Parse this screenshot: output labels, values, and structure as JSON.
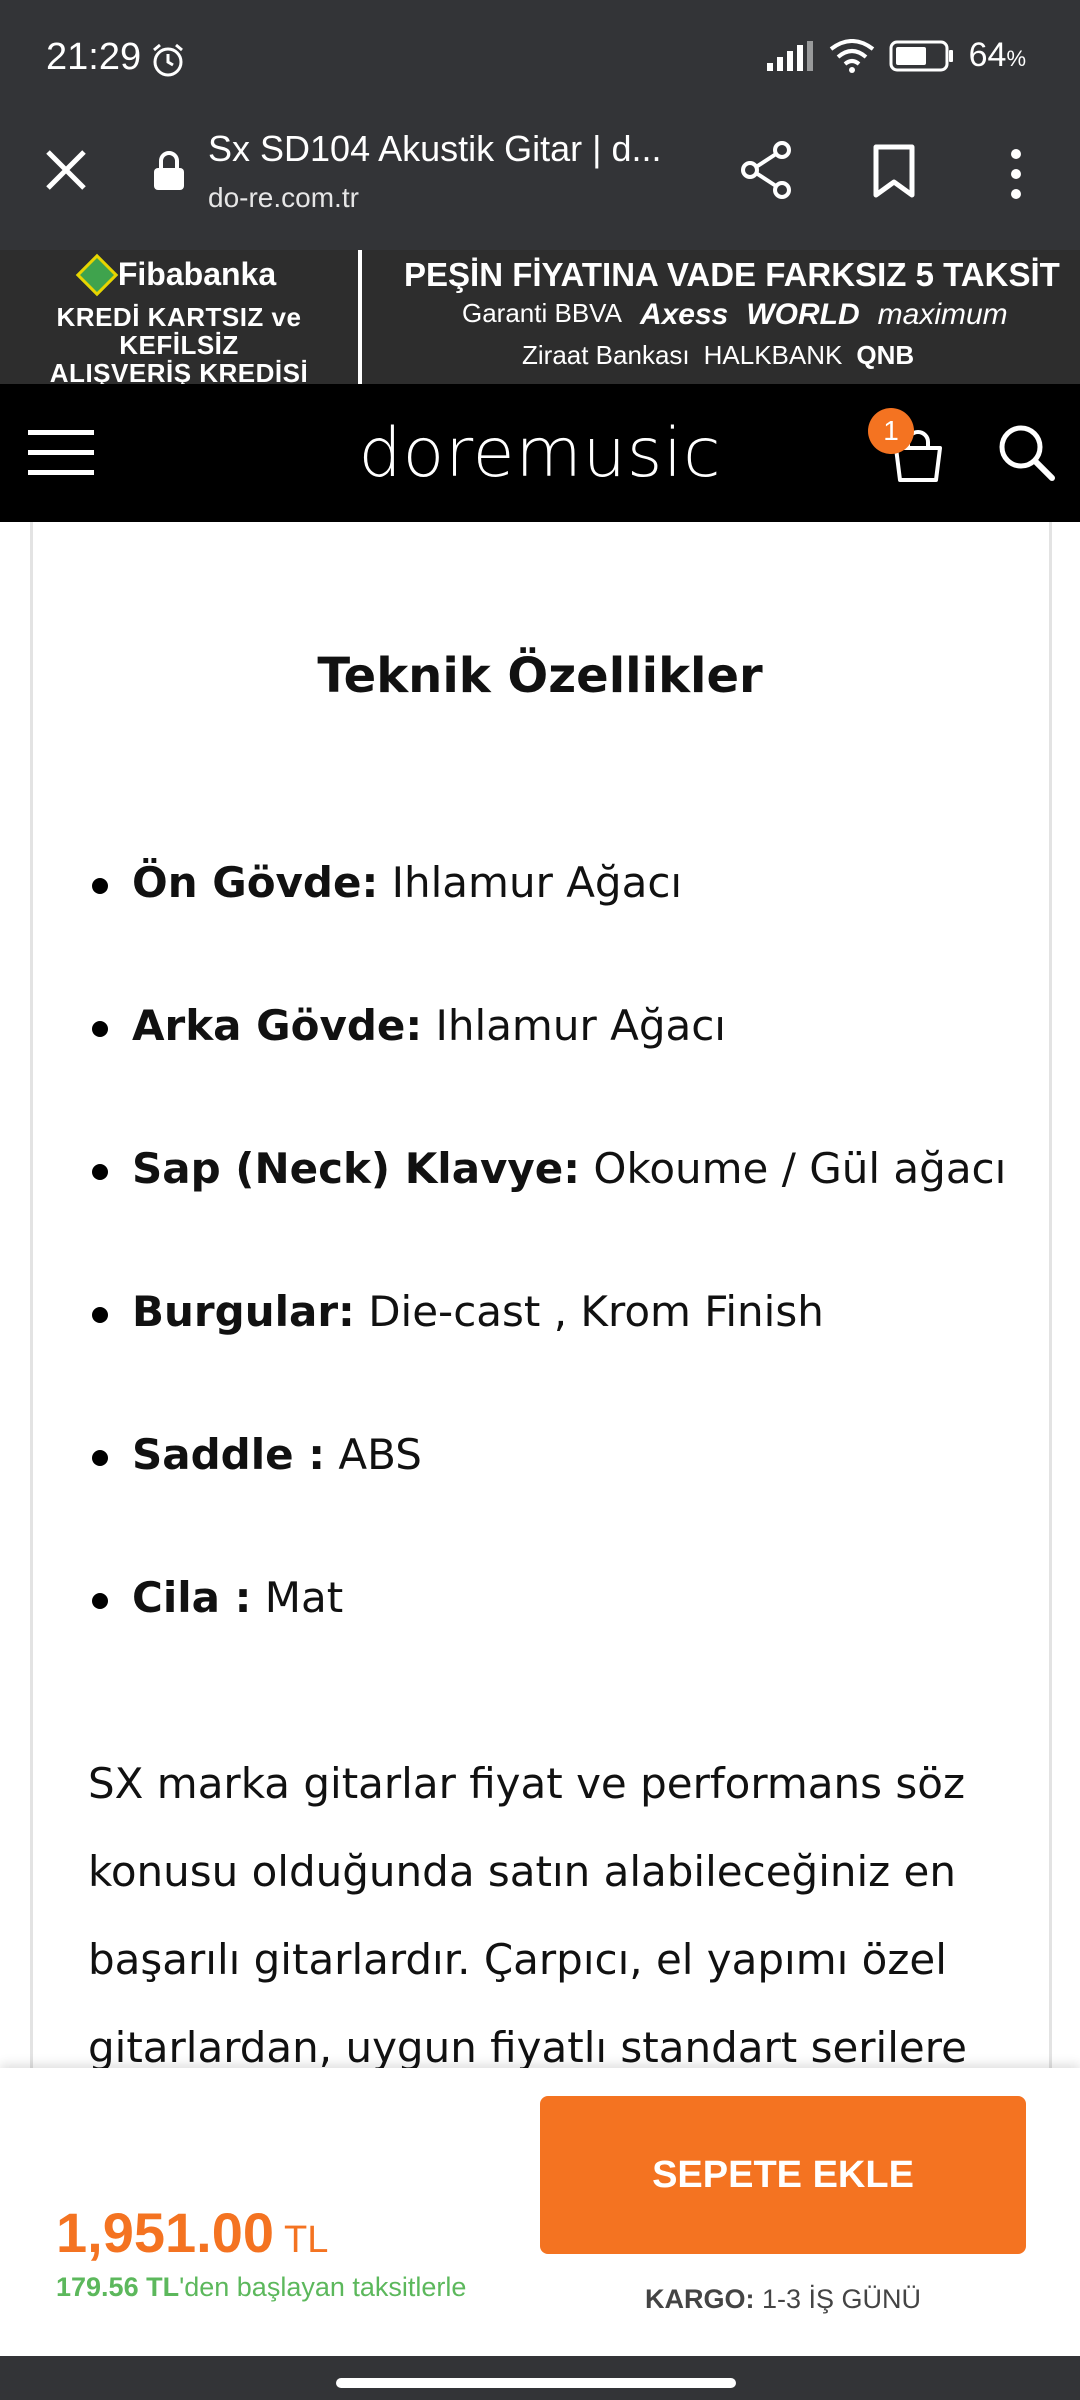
{
  "status": {
    "time": "21:29",
    "battery": "64",
    "battery_unit": "%"
  },
  "browser": {
    "title": "Sx SD104 Akustik Gitar | d...",
    "url": "do-re.com.tr"
  },
  "banner": {
    "brand": "Fibabanka",
    "left_line1": "KREDİ KARTSIZ ve KEFİLSİZ",
    "left_line2": "ALIŞVERİŞ KREDİSİ",
    "headline": "PEŞİN FİYATINA VADE FARKSIZ 5 TAKSİT",
    "banks_row1": [
      "Garanti BBVA",
      "Axess",
      "WORLD",
      "maximum"
    ],
    "banks_row2": [
      "Ziraat Bankası",
      "HALKBANK",
      "QNB"
    ]
  },
  "header": {
    "logo": "doremusic",
    "cart_count": "1"
  },
  "content": {
    "section_title": "Teknik Özellikler",
    "specs": [
      {
        "label": "Ön Gövde:",
        "value": " Ihlamur Ağacı"
      },
      {
        "label": "Arka Gövde:",
        "value": " Ihlamur Ağacı"
      },
      {
        "label": "Sap (Neck) Klavye:",
        "value": " Okoume / Gül ağacı"
      },
      {
        "label": "Burgular:",
        "value": " Die-cast , Krom Finish"
      },
      {
        "label": "Saddle :",
        "value": " ABS"
      },
      {
        "label": "Cila :",
        "value": " Mat"
      }
    ],
    "description": "SX marka gitarlar fiyat ve performans söz konusu olduğunda satın alabileceğiniz en başarılı gitarlardır. Çarpıcı, el yapımı özel gitarlardan, uygun fiyatlı standart serilere"
  },
  "purchase": {
    "price": "1,951.00",
    "currency": "TL",
    "installment_amount": "179.56 TL",
    "installment_text": "'den başlayan taksitlerle",
    "button_label": "SEPETE EKLE",
    "shipping_label": "KARGO:",
    "shipping_value": " 1-3 İŞ GÜNÜ"
  },
  "colors": {
    "accent": "#f47321",
    "installment": "#5cb85c",
    "header_bg": "#000000",
    "chrome_bg": "#333437"
  }
}
